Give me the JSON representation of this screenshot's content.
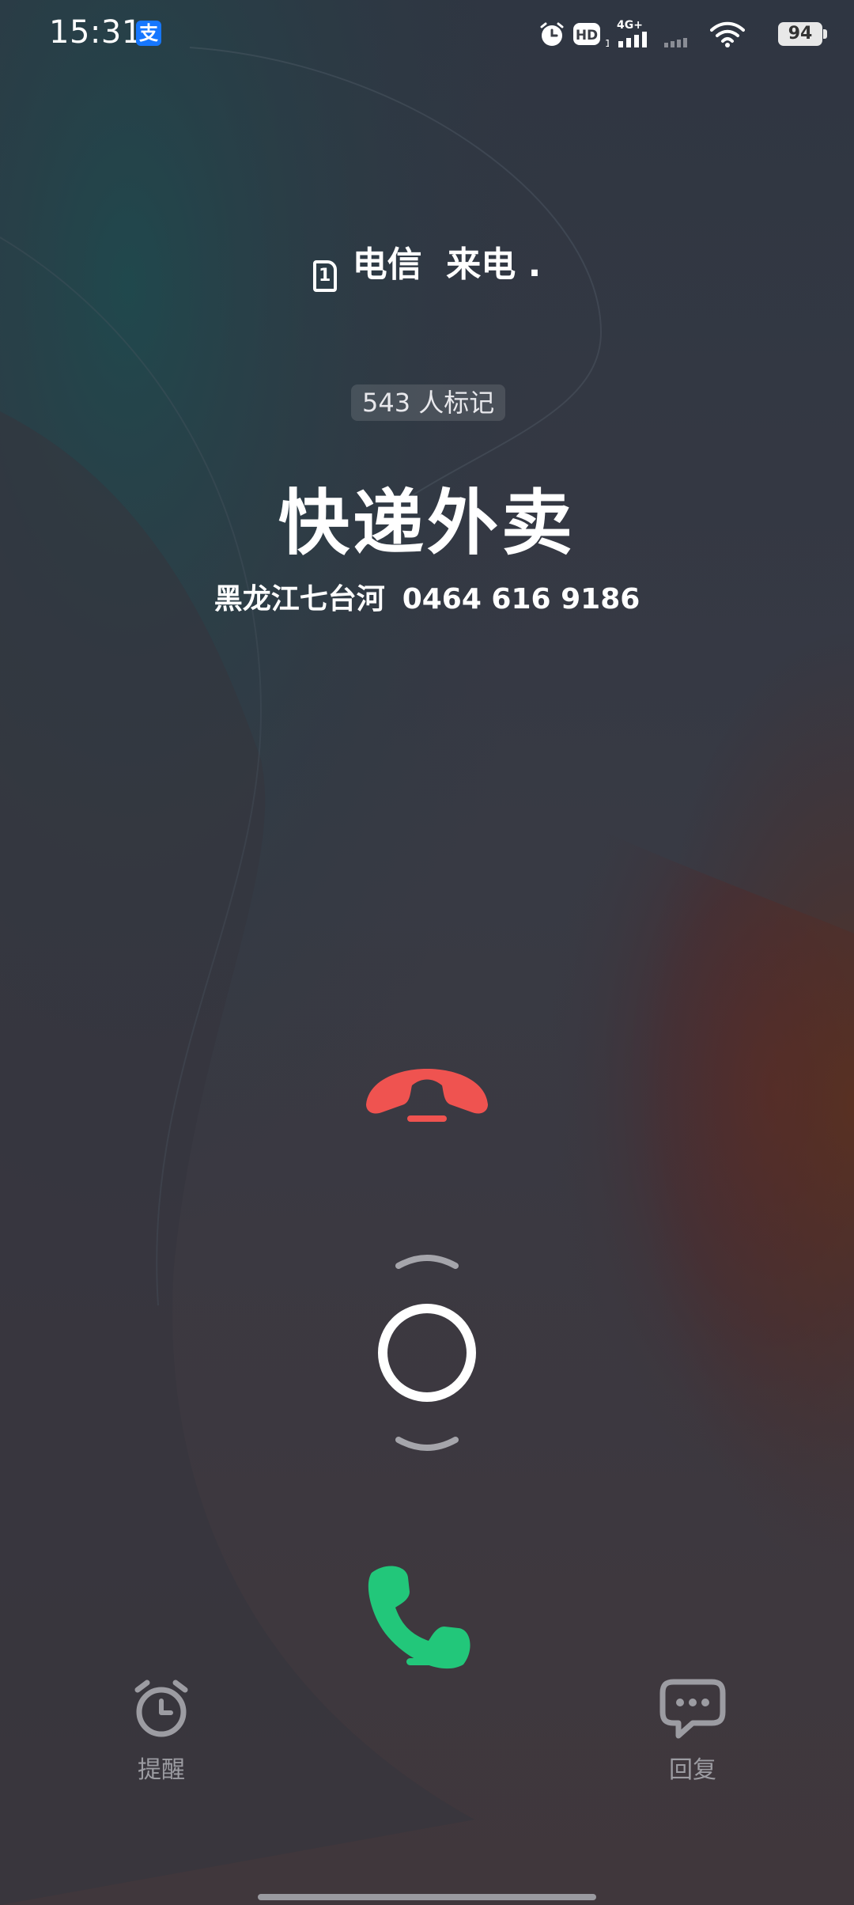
{
  "status_bar": {
    "time": "15:31",
    "notification_icon": "alipay-icon",
    "alipay_glyph": "支",
    "hd_label": "HD",
    "sim_sub": "1",
    "network_label": "4G+",
    "battery_level": "94",
    "icons": [
      "alarm-icon",
      "hd-volte-icon",
      "signal-4g-icon",
      "signal-sim2-icon",
      "wifi-icon",
      "battery-icon"
    ]
  },
  "call": {
    "sim_badge": "1",
    "carrier": "电信",
    "status": "来电 .",
    "marked_count": "543 人标记",
    "caller_name": "快递外卖",
    "location": "黑龙江七台河",
    "number": "0464 616 9186"
  },
  "controls": {
    "decline": "decline-call-icon",
    "slider": "answer-slider-handle",
    "answer": "answer-call-icon",
    "colors": {
      "decline": "#ef5350",
      "answer": "#22c77a"
    }
  },
  "actions": {
    "remind_label": "提醒",
    "reply_label": "回复"
  }
}
